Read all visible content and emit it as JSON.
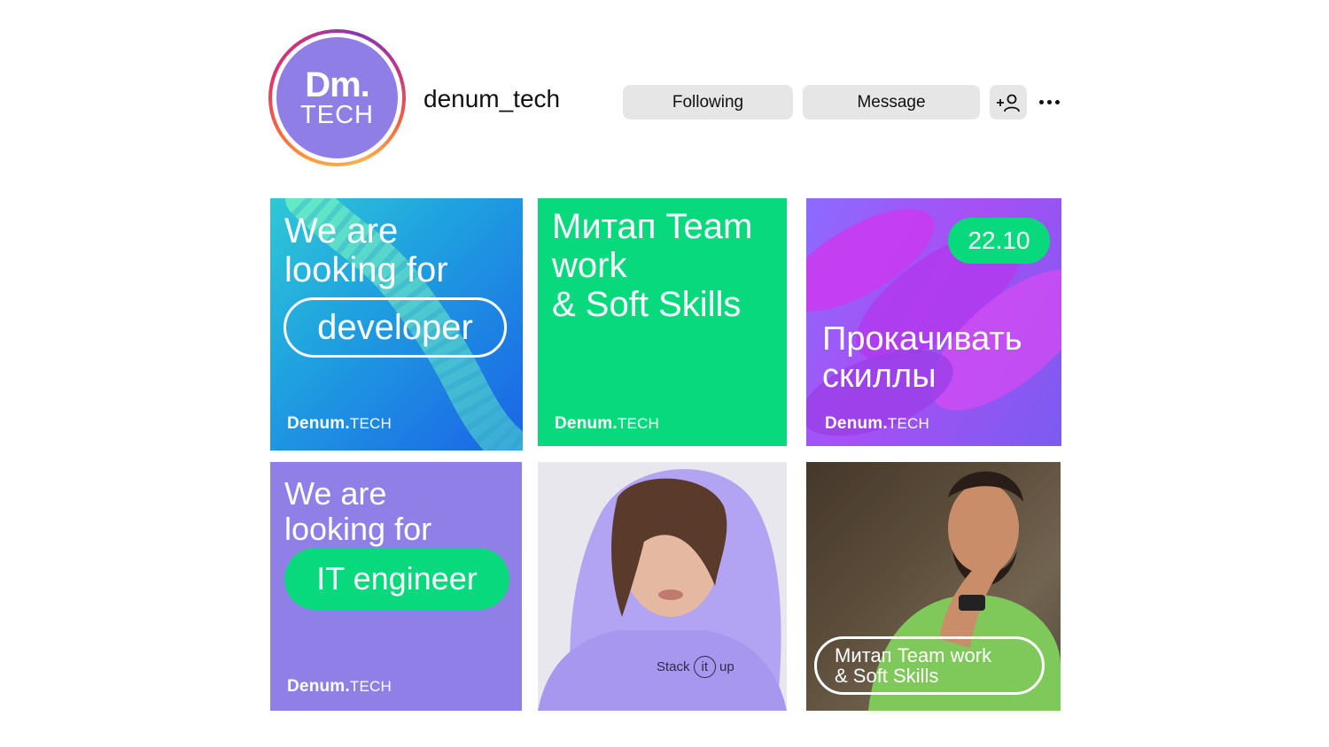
{
  "profile": {
    "avatar_line1": "Dm.",
    "avatar_line2": "TECH",
    "username": "denum_tech",
    "following_label": "Following",
    "message_label": "Message"
  },
  "icons": {
    "add_user": "add-user-icon",
    "more": "more-icon"
  },
  "colors": {
    "brand_purple": "#8f7ee6",
    "brand_green": "#08d97d",
    "button_gray": "#e6e6e6"
  },
  "posts": [
    {
      "line1": "We are",
      "line2": "looking for",
      "pill": "developer",
      "brand_bold": "Denum.",
      "brand_light": "TECH"
    },
    {
      "line1": "Митап Team",
      "line2": "work",
      "line3": "& Soft Skills",
      "brand_bold": "Denum.",
      "brand_light": "TECH"
    },
    {
      "badge": "22.10",
      "line1": "Прокачивать",
      "line2": "скиллы",
      "brand_bold": "Denum.",
      "brand_light": "TECH"
    },
    {
      "line1": "We are",
      "line2": "looking for",
      "pill": "IT engineer",
      "brand_bold": "Denum.",
      "brand_light": "TECH"
    },
    {
      "hoodie_word1": "Stack",
      "hoodie_word2": "it",
      "hoodie_word3": "up"
    },
    {
      "line1": "Митап Team work",
      "line2": "& Soft Skills"
    }
  ]
}
